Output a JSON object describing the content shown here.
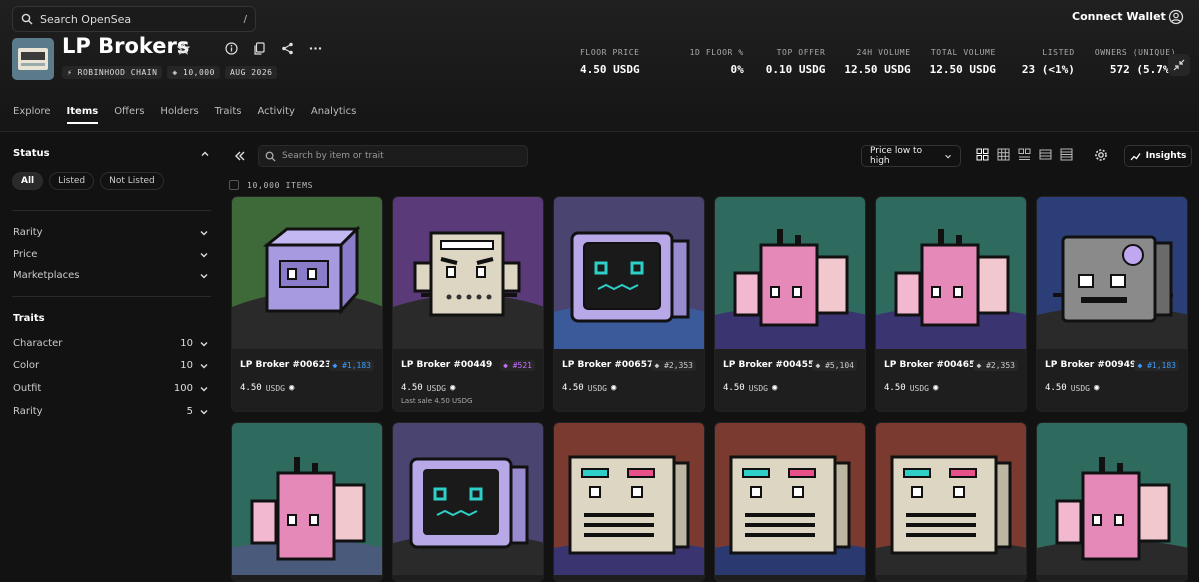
{
  "search": {
    "placeholder": "Search OpenSea",
    "shortcut": "/"
  },
  "header": {
    "connect_label": "Connect Wallet"
  },
  "collection": {
    "title": "LP Brokers",
    "chips": [
      "ROBINHOOD CHAIN",
      "10,000",
      "AUG 2026"
    ]
  },
  "stats": [
    {
      "label": "FLOOR PRICE",
      "value": "4.50 USDG"
    },
    {
      "label": "1D FLOOR %",
      "value": "0%"
    },
    {
      "label": "TOP OFFER",
      "value": "0.10 USDG"
    },
    {
      "label": "24H VOLUME",
      "value": "12.50 USDG"
    },
    {
      "label": "TOTAL VOLUME",
      "value": "12.50 USDG"
    },
    {
      "label": "LISTED",
      "value": "23 (<1%)"
    },
    {
      "label": "OWNERS (UNIQUE)",
      "value": "572 (5.7%)"
    }
  ],
  "tabs": [
    "Explore",
    "Items",
    "Offers",
    "Holders",
    "Traits",
    "Activity",
    "Analytics"
  ],
  "sidebar": {
    "status_title": "Status",
    "status_options": [
      "All",
      "Listed",
      "Not Listed"
    ],
    "filters": [
      "Rarity",
      "Price",
      "Marketplaces"
    ],
    "traits_title": "Traits",
    "traits": [
      {
        "name": "Character",
        "count": "10"
      },
      {
        "name": "Color",
        "count": "10"
      },
      {
        "name": "Outfit",
        "count": "100"
      },
      {
        "name": "Rarity",
        "count": "5"
      }
    ]
  },
  "toolbar": {
    "search_placeholder": "Search by item or trait",
    "sort_label": "Price low to high",
    "insights_label": "Insights"
  },
  "items_count": "10,000 ITEMS",
  "colors": {
    "accent_blue": "#3b9cff",
    "accent_purple": "#c86cff"
  },
  "items": [
    {
      "name": "LP Broker #00623",
      "rank": "#1,183",
      "price": "4.50",
      "unit": "USDG",
      "last": "",
      "rank_color": "#3b9cff"
    },
    {
      "name": "LP Broker #00449",
      "rank": "#521",
      "price": "4.50",
      "unit": "USDG",
      "last": "Last sale 4.50 USDG",
      "rank_color": "#c86cff"
    },
    {
      "name": "LP Broker #00657",
      "rank": "#2,353",
      "price": "4.50",
      "unit": "USDG",
      "last": "",
      "rank_color": "#cccccc"
    },
    {
      "name": "LP Broker #00455",
      "rank": "#5,104",
      "price": "4.50",
      "unit": "USDG",
      "last": "",
      "rank_color": "#cccccc"
    },
    {
      "name": "LP Broker #00465",
      "rank": "#2,353",
      "price": "4.50",
      "unit": "USDG",
      "last": "",
      "rank_color": "#cccccc"
    },
    {
      "name": "LP Broker #00949",
      "rank": "#1,183",
      "price": "4.50",
      "unit": "USDG",
      "last": "",
      "rank_color": "#3b9cff"
    }
  ]
}
